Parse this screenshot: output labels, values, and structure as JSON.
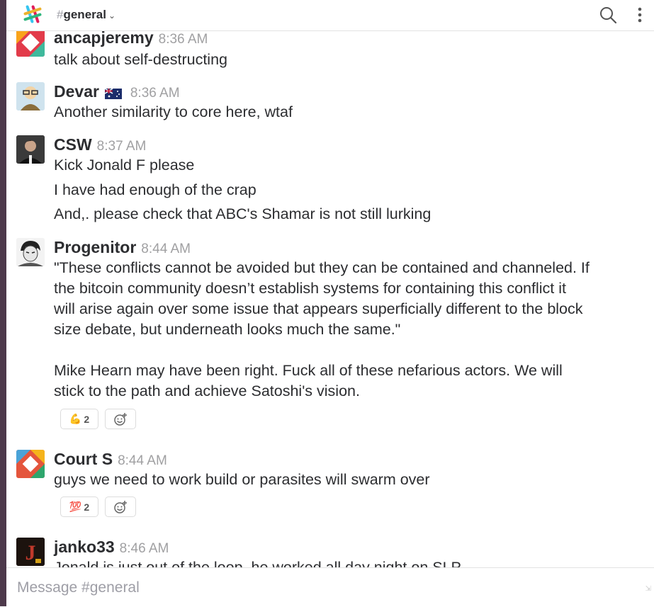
{
  "header": {
    "hash": "#",
    "channel": "general",
    "chevron": "⌄"
  },
  "messages": [
    {
      "author": "ancapjeremy",
      "time": "8:36 AM",
      "avatar_icon": "slack-style-avatar",
      "lines": [
        "talk about self-destructing"
      ]
    },
    {
      "author": "Devar",
      "flag_icon": "australia-flag-icon",
      "time": "8:36 AM",
      "avatar_icon": "cartoon-avatar",
      "lines": [
        "Another similarity to core here, wtaf"
      ]
    },
    {
      "author": "CSW",
      "time": "8:37 AM",
      "avatar_icon": "photo-avatar",
      "lines": [
        "Kick Jonald F please",
        "I have had enough of the crap",
        "And,. please check that ABC's Shamar is not still lurking"
      ]
    },
    {
      "author": "Progenitor",
      "time": "8:44 AM",
      "avatar_icon": "manga-avatar",
      "lines": [
        "\"These conflicts cannot be avoided but they can be contained and channeled. If",
        "the bitcoin community doesn’t establish systems for containing this conflict it",
        "will arise again over some issue that appears superficially different to the block",
        "size debate, but underneath looks much the same.\"",
        "",
        "Mike Hearn may have been right. Fuck all of these nefarious actors. We will",
        "stick to the path and achieve Satoshi's vision."
      ],
      "reaction": {
        "emoji": "💪",
        "count": "2"
      }
    },
    {
      "author": "Court S",
      "time": "8:44 AM",
      "avatar_icon": "slack-style-avatar",
      "lines": [
        "guys we need to work build or parasites will swarm over"
      ],
      "reaction": {
        "emoji": "💯",
        "count": "2"
      }
    },
    {
      "author": "janko33",
      "time": "8:46 AM",
      "avatar_icon": "letter-j-avatar",
      "lines": [
        "Jonald is just out of the loop, he worked all day night on SLP"
      ]
    }
  ],
  "add_reaction_icon": "add-reaction-icon",
  "composer": {
    "placeholder": "Message #general"
  },
  "colors": {
    "sidebar": "#4d394b",
    "timestamp": "#a0a0a2",
    "text": "#2c2d30"
  }
}
